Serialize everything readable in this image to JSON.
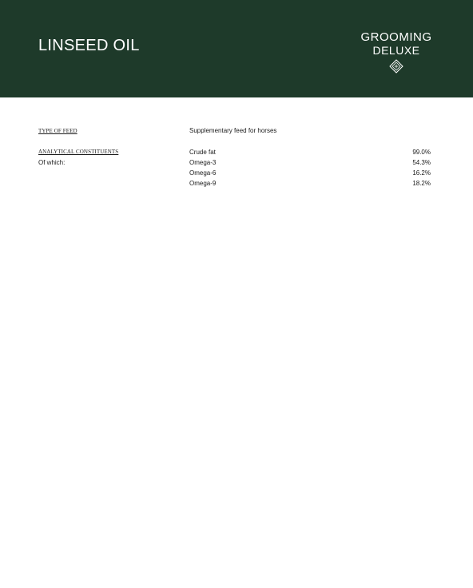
{
  "header": {
    "title": "LINSEED OIL",
    "brand_line1": "GROOMING",
    "brand_line2": "DELUXE",
    "brand_mark": "diamond-monogram-logo",
    "background": "#1e3a2a"
  },
  "type_of_feed": {
    "label": "TYPE OF FEED",
    "value": "Supplementary feed for horses"
  },
  "analytical": {
    "label": "ANALYTICAL CONSTITUENTS",
    "sublabel": "Of which:",
    "rows": [
      {
        "name": "Crude fat",
        "value": "99.0%"
      },
      {
        "name": "Omega-3",
        "value": "54.3%"
      },
      {
        "name": "Omega-6",
        "value": "16.2%"
      },
      {
        "name": "Omega-9",
        "value": "18.2%"
      }
    ]
  }
}
